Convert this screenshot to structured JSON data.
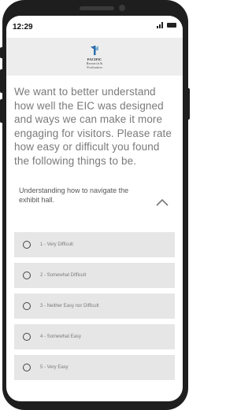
{
  "status": {
    "time": "12:29"
  },
  "logo": {
    "lines": [
      "PACIFIC",
      "Research &",
      "Evaluation"
    ]
  },
  "intro": "We want to better understand how well the EIC was designed and ways we can make it more engaging for visitors. Please rate how easy or difficult you found the following things to be.",
  "question": {
    "text": "Understanding how to navigate the exhibit hall.",
    "icon": "chevron-up-icon"
  },
  "options": [
    {
      "label": "1 - Very Difficult"
    },
    {
      "label": "2 - Somewhat Difficult"
    },
    {
      "label": "3 - Neither Easy nor Difficult"
    },
    {
      "label": "4 - Somewhat Easy"
    },
    {
      "label": "5 - Very Easy"
    }
  ],
  "colors": {
    "logo_band": "#ededed",
    "option_bg": "#e6e6e6",
    "text_gray": "#7a7a7a",
    "logo_blue": "#2e6fa8"
  }
}
